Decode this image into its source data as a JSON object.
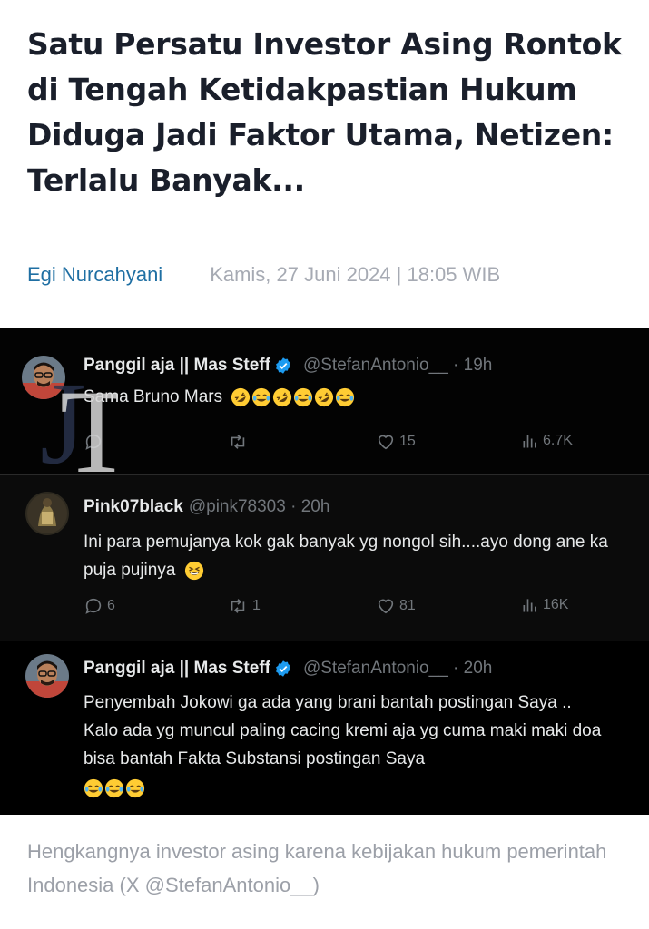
{
  "article": {
    "title": "Satu Persatu Investor Asing Rontok di Tengah Ketidakpastian Hukum Diduga Jadi Faktor Utama, Netizen: Terlalu Banyak...",
    "author": "Egi Nurcahyani",
    "date": "Kamis, 27 Juni 2024 | 18:05 WIB"
  },
  "screenshot": {
    "tweets": [
      {
        "name": "Panggil aja || Mas Steff",
        "verified": true,
        "handle_time": "@StefanAntonio__ · 19h",
        "text": "Sama Bruno Mars",
        "emojis": [
          "rolling-laugh",
          "tears-of-joy",
          "rolling-laugh",
          "tears-of-joy",
          "rolling-laugh",
          "tears-of-joy"
        ],
        "stats": {
          "reply": "",
          "retweet": "",
          "like": "15",
          "views": "6.7K"
        }
      },
      {
        "name": "Pink07black",
        "verified": false,
        "handle_time": "@pink78303 · 20h",
        "text_line1": "Ini para pemujanya kok gak banyak yg nongol sih....ayo dong ane ka",
        "text_line2": "puja pujinya",
        "emojis": [
          "grinning-squint"
        ],
        "stats": {
          "reply": "6",
          "retweet": "1",
          "like": "81",
          "views": "16K"
        }
      },
      {
        "name": "Panggil aja || Mas Steff",
        "verified": true,
        "handle_time": "@StefanAntonio__ · 20h",
        "text_line1": "Penyembah Jokowi ga ada yang brani bantah postingan Saya ..",
        "text_line2": "Kalo ada yg muncul paling cacing kremi aja yg cuma maki maki doa",
        "text_line3": "bisa bantah Fakta Substansi postingan Saya",
        "emojis": [
          "tears-of-joy",
          "tears-of-joy",
          "tears-of-joy"
        ]
      }
    ],
    "colors": {
      "background": "#000000",
      "text": "#e7e9ea",
      "muted": "#71767b",
      "verified": "#1d9bf0"
    }
  },
  "caption": "Hengkangnya investor asing karena kebijakan hukum pemerintah Indonesia (X @StefanAntonio__)"
}
